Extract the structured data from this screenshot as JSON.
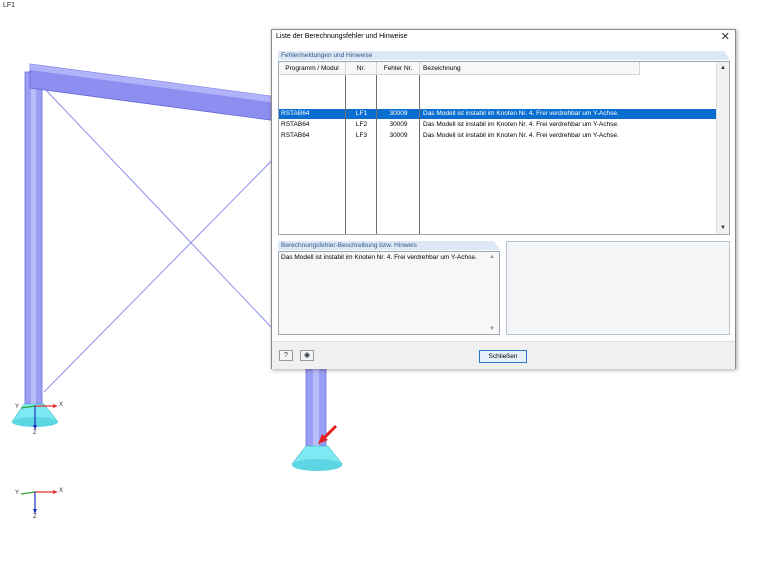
{
  "viewport": {
    "load_case_label": "LF1",
    "axis_labels": {
      "x": "X",
      "y": "Y",
      "z": "Z"
    }
  },
  "dialog": {
    "title": "Liste der Berechnungsfehler und Hinweise",
    "messages_section": "Fehlermeldungen und Hinweise",
    "columns": [
      "Programm / Modul",
      "Nr.",
      "Fehler Nr.",
      "Bezeichnung"
    ],
    "rows": [
      {
        "module": "RSTAB64",
        "nr": "LF1",
        "error_no": "30009",
        "description": "Das Modell ist instabil im Knoten Nr. 4. Frei verdrehbar um Y-Achse."
      },
      {
        "module": "RSTAB64",
        "nr": "LF2",
        "error_no": "30009",
        "description": "Das Modell ist instabil im Knoten Nr. 4. Frei verdrehbar um Y-Achse."
      },
      {
        "module": "RSTAB64",
        "nr": "LF3",
        "error_no": "30009",
        "description": "Das Modell ist instabil im Knoten Nr. 4. Frei verdrehbar um Y-Achse."
      }
    ],
    "selected_row": 0,
    "description_section": "Berechnungsfehler-Beschreibung bzw. Hinweis",
    "description_text": "Das Modell ist instabil im Knoten Nr. 4. Frei verdrehbar um Y-Achse.",
    "close_label": "Schließen",
    "help_icon": "?",
    "view_icon": "◉"
  },
  "colors": {
    "member": "#8a8aee",
    "support": "#6fe5f0",
    "selection": "#0a6ed1",
    "marker": "#e02020"
  }
}
